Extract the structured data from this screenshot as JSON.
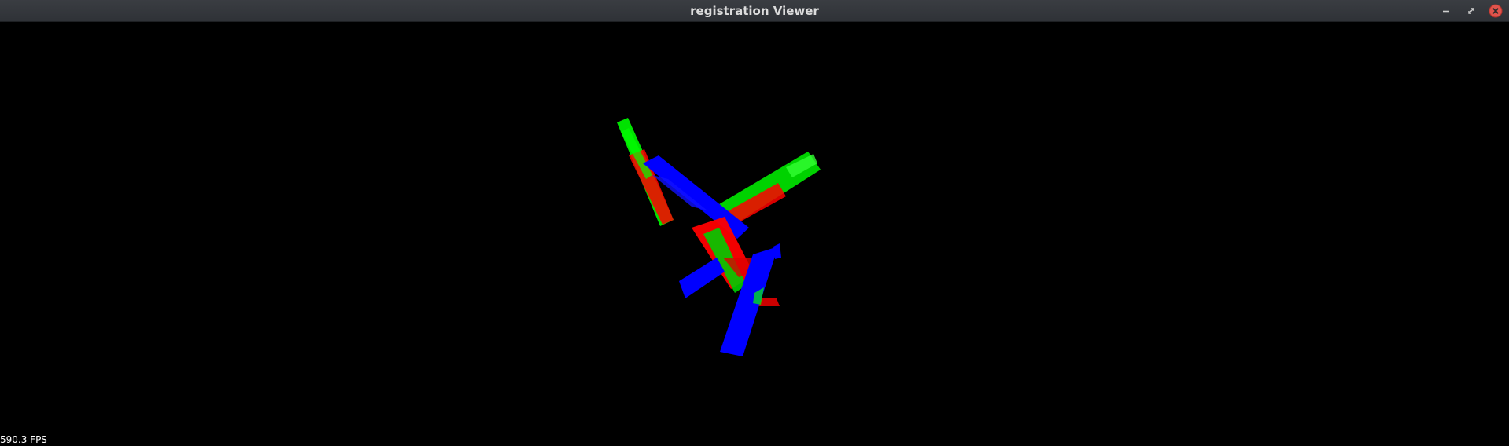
{
  "window": {
    "title": "registration Viewer",
    "controls": {
      "minimize": "minimize-icon",
      "maximize": "maximize-icon",
      "close": "close-icon"
    }
  },
  "viewer": {
    "background": "#000000",
    "fps_label": "590.3 FPS",
    "point_colors": {
      "source": "#ff0000",
      "target": "#00ff00",
      "aligned": "#0000ff"
    }
  }
}
